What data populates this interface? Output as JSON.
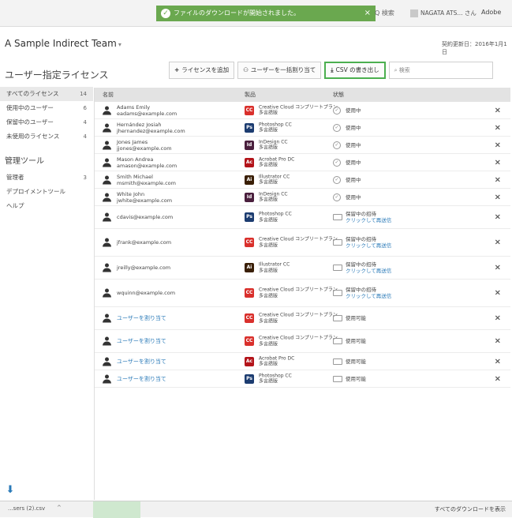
{
  "topbar": {
    "toast_text": "ファイルのダウンロードが開始されました。",
    "toast_close": "×",
    "search_label": "Q 検索",
    "user_label": "NAGATA ATS... さん",
    "adobe_label": "Adobe"
  },
  "team": {
    "name": "A Sample Indirect Team",
    "caret": "▾",
    "contract": "契約更新日：2016年1月1日"
  },
  "section_title": "ユーザー指定ライセンス",
  "toolbar": {
    "add_license": "ライセンスを追加",
    "bulk_assign": "ユーザーを一括割り当て",
    "csv_export": "CSV の書き出し",
    "search_placeholder": "検索"
  },
  "sidebar": {
    "items": [
      {
        "label": "すべてのライセンス",
        "count": "14"
      },
      {
        "label": "使用中のユーザー",
        "count": "6"
      },
      {
        "label": "保留中のユーザー",
        "count": "4"
      },
      {
        "label": "未使用のライセンス",
        "count": "4"
      }
    ],
    "admin_head": "管理ツール",
    "admin_items": [
      {
        "label": "管理者",
        "count": "3"
      },
      {
        "label": "デプロイメントツール",
        "count": ""
      },
      {
        "label": "ヘルプ",
        "count": ""
      }
    ]
  },
  "table": {
    "headers": {
      "name": "名前",
      "product": "製品",
      "status": "状態"
    },
    "rows": [
      {
        "name": "Adams Emily",
        "email": "eadams@example.com",
        "product": "Creative Cloud コンプリートプラン",
        "product2": "多言語版",
        "icon": "CC",
        "icon_color": "#d9302c",
        "status": "使用中",
        "resend": ""
      },
      {
        "name": "Hernández Josiah",
        "email": "jhernandez@example.com",
        "product": "Photoshop CC",
        "product2": "多言語版",
        "icon": "Ps",
        "icon_color": "#1c3c70",
        "status": "使用中",
        "resend": ""
      },
      {
        "name": "Jones James",
        "email": "jjones@example.com",
        "product": "InDesign CC",
        "product2": "多言語版",
        "icon": "Id",
        "icon_color": "#4a1f3d",
        "status": "使用中",
        "resend": ""
      },
      {
        "name": "Mason Andrea",
        "email": "amason@example.com",
        "product": "Acrobat Pro DC",
        "product2": "多言語版",
        "icon": "Ac",
        "icon_color": "#b3141a",
        "status": "使用中",
        "resend": ""
      },
      {
        "name": "Smith Michael",
        "email": "msmith@example.com",
        "product": "Illustrator CC",
        "product2": "多言語版",
        "icon": "Ai",
        "icon_color": "#3a1f06",
        "status": "使用中",
        "resend": ""
      },
      {
        "name": "White John",
        "email": "jwhite@example.com",
        "product": "InDesign CC",
        "product2": "多言語版",
        "icon": "Id",
        "icon_color": "#4a1f3d",
        "status": "使用中",
        "resend": ""
      },
      {
        "name": "",
        "email": "cdavis@example.com",
        "product": "Photoshop CC",
        "product2": "多言語版",
        "icon": "Ps",
        "icon_color": "#1c3c70",
        "status": "保留中の招待",
        "resend": "クリックして再送信"
      },
      {
        "name": "",
        "email": "jfrank@example.com",
        "product": "Creative Cloud コンプリートプラン",
        "product2": "多言語版",
        "icon": "CC",
        "icon_color": "#d9302c",
        "status": "保留中の招待",
        "resend": "クリックして再送信"
      },
      {
        "name": "",
        "email": "jreilly@example.com",
        "product": "Illustrator CC",
        "product2": "多言語版",
        "icon": "Ai",
        "icon_color": "#3a1f06",
        "status": "保留中の招待",
        "resend": "クリックして再送信"
      },
      {
        "name": "",
        "email": "wquinn@example.com",
        "product": "Creative Cloud コンプリートプラン",
        "product2": "多言語版",
        "icon": "CC",
        "icon_color": "#d9302c",
        "status": "保留中の招待",
        "resend": "クリックして再送信"
      },
      {
        "name": "ユーザーを割り当て",
        "email": "",
        "product": "Creative Cloud コンプリートプラン",
        "product2": "多言語版",
        "icon": "CC",
        "icon_color": "#d9302c",
        "status": "使用可能",
        "resend": ""
      },
      {
        "name": "ユーザーを割り当て",
        "email": "",
        "product": "Creative Cloud コンプリートプラン",
        "product2": "多言語版",
        "icon": "CC",
        "icon_color": "#d9302c",
        "status": "使用可能",
        "resend": ""
      },
      {
        "name": "ユーザーを割り当て",
        "email": "",
        "product": "Acrobat Pro DC",
        "product2": "多言語版",
        "icon": "Ac",
        "icon_color": "#b3141a",
        "status": "使用可能",
        "resend": ""
      },
      {
        "name": "ユーザーを割り当て",
        "email": "",
        "product": "Photoshop CC",
        "product2": "多言語版",
        "icon": "Ps",
        "icon_color": "#1c3c70",
        "status": "使用可能",
        "resend": ""
      }
    ]
  },
  "downloads": {
    "file": "...sers (2).csv",
    "caret": "^",
    "show_all": "すべてのダウンロードを表示"
  }
}
